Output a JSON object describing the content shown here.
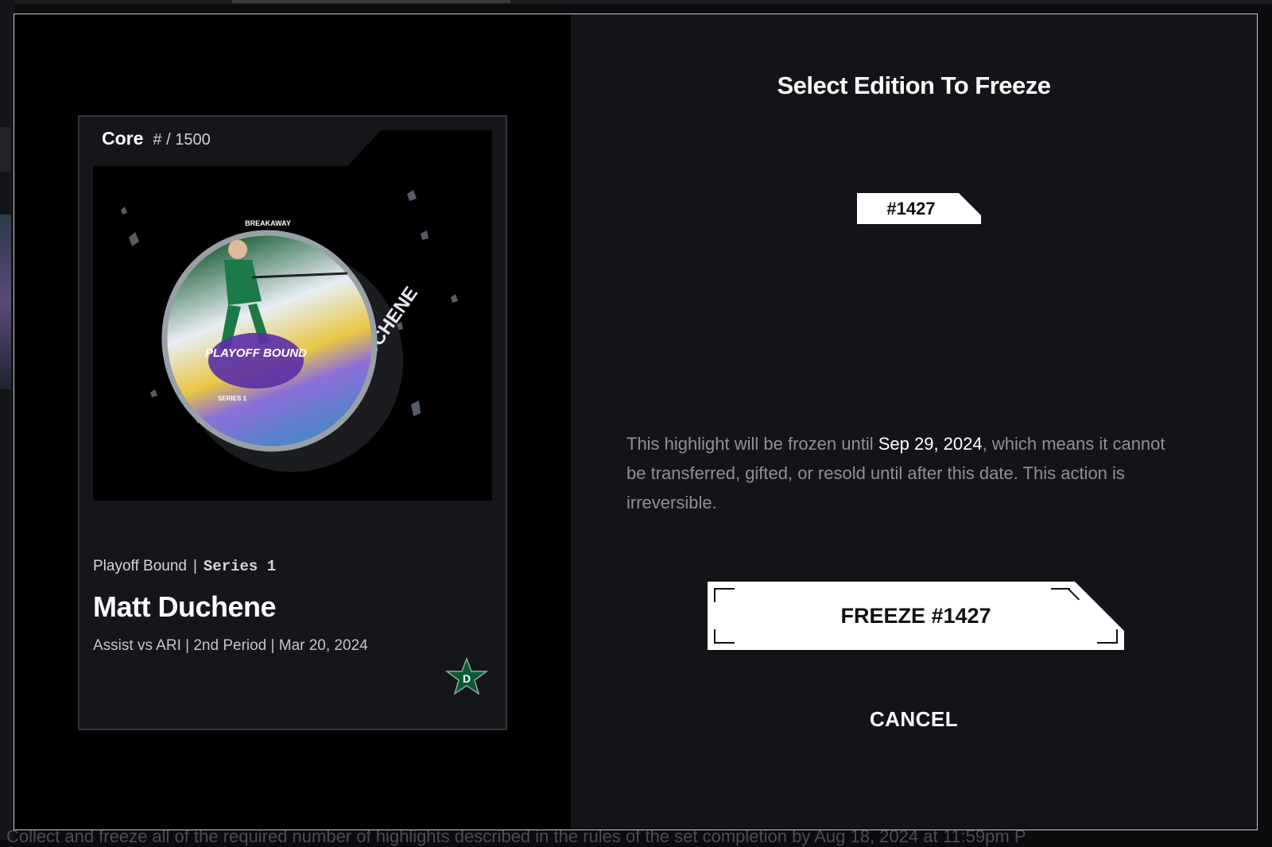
{
  "background": {
    "bottom_text": "Collect and freeze all of the required number of highlights described in the rules of the set completion by Aug 18, 2024 at 11:59pm P"
  },
  "modal": {
    "title": "Select Edition To Freeze",
    "card": {
      "tier": "Core",
      "serial": "# / 1500",
      "set_name": "Playoff Bound",
      "separator": "|",
      "series": "Series 1",
      "player": "Matt Duchene",
      "details": "Assist vs ARI | 2nd Period | Mar 20, 2024",
      "media_icon": "hockey-puck-image",
      "puck_text": "MATT DUCHENE",
      "puck_logo_text": "PLAYOFF BOUND",
      "puck_brand": "BREAKAWAY",
      "puck_series": "SERIES 1",
      "team_icon": "dallas-stars-logo-icon",
      "accent_color": "#006847"
    },
    "edition_chip": "#1427",
    "description": {
      "before": "This highlight will be frozen until ",
      "date": "Sep 29, 2024",
      "after": ", which means it cannot be transferred, gifted, or resold until after this date. This action is irreversible."
    },
    "freeze_button": "FREEZE #1427",
    "cancel_button": "CANCEL"
  }
}
